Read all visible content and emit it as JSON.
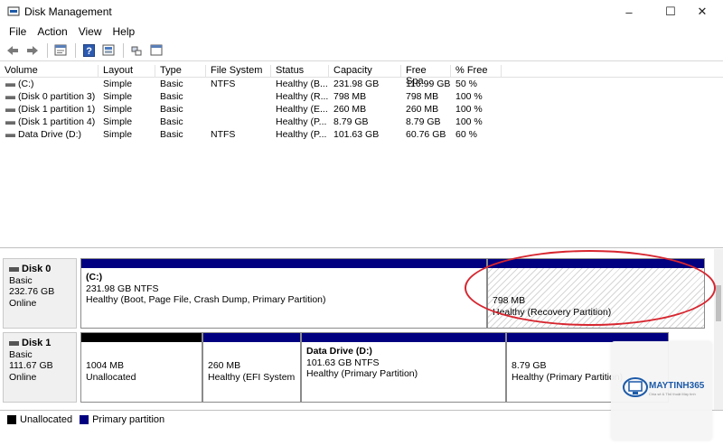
{
  "window": {
    "title": "Disk Management"
  },
  "menu": {
    "file": "File",
    "action": "Action",
    "view": "View",
    "help": "Help"
  },
  "columns": [
    "Volume",
    "Layout",
    "Type",
    "File System",
    "Status",
    "Capacity",
    "Free Spa...",
    "% Free"
  ],
  "volumes": [
    {
      "volume": "(C:)",
      "layout": "Simple",
      "type": "Basic",
      "fs": "NTFS",
      "status": "Healthy (B...",
      "capacity": "231.98 GB",
      "free": "116.99 GB",
      "pct": "50 %"
    },
    {
      "volume": "(Disk 0 partition 3)",
      "layout": "Simple",
      "type": "Basic",
      "fs": "",
      "status": "Healthy (R...",
      "capacity": "798 MB",
      "free": "798 MB",
      "pct": "100 %"
    },
    {
      "volume": "(Disk 1 partition 1)",
      "layout": "Simple",
      "type": "Basic",
      "fs": "",
      "status": "Healthy (E...",
      "capacity": "260 MB",
      "free": "260 MB",
      "pct": "100 %"
    },
    {
      "volume": "(Disk 1 partition 4)",
      "layout": "Simple",
      "type": "Basic",
      "fs": "",
      "status": "Healthy (P...",
      "capacity": "8.79 GB",
      "free": "8.79 GB",
      "pct": "100 %"
    },
    {
      "volume": "Data Drive (D:)",
      "layout": "Simple",
      "type": "Basic",
      "fs": "NTFS",
      "status": "Healthy (P...",
      "capacity": "101.63 GB",
      "free": "60.76 GB",
      "pct": "60 %"
    }
  ],
  "disk0": {
    "name": "Disk 0",
    "type": "Basic",
    "size": "232.76 GB",
    "state": "Online",
    "p1": {
      "title": "(C:)",
      "size": "231.98 GB NTFS",
      "status": "Healthy (Boot, Page File, Crash Dump, Primary Partition)"
    },
    "p2": {
      "size": "798 MB",
      "status": "Healthy (Recovery Partition)"
    }
  },
  "disk1": {
    "name": "Disk 1",
    "type": "Basic",
    "size": "111.67 GB",
    "state": "Online",
    "p1": {
      "size": "1004 MB",
      "status": "Unallocated"
    },
    "p2": {
      "size": "260 MB",
      "status": "Healthy (EFI System P"
    },
    "p3": {
      "title": "Data Drive  (D:)",
      "size": "101.63 GB NTFS",
      "status": "Healthy (Primary Partition)"
    },
    "p4": {
      "size": "8.79 GB",
      "status": "Healthy (Primary Partition)"
    }
  },
  "legend": {
    "unallocated": "Unallocated",
    "primary": "Primary partition"
  },
  "colors": {
    "primary": "#000080",
    "unallocated": "#000000",
    "annotation": "#d7262f"
  },
  "watermark": {
    "brand": "MAYTINH365",
    "tagline": "Chia sẻ & Thủ thuật Máy tính"
  },
  "icons": [
    "disk-management-icon",
    "back-arrow-icon",
    "forward-arrow-icon",
    "properties-icon",
    "help-icon",
    "refresh-icon",
    "console-icon"
  ]
}
